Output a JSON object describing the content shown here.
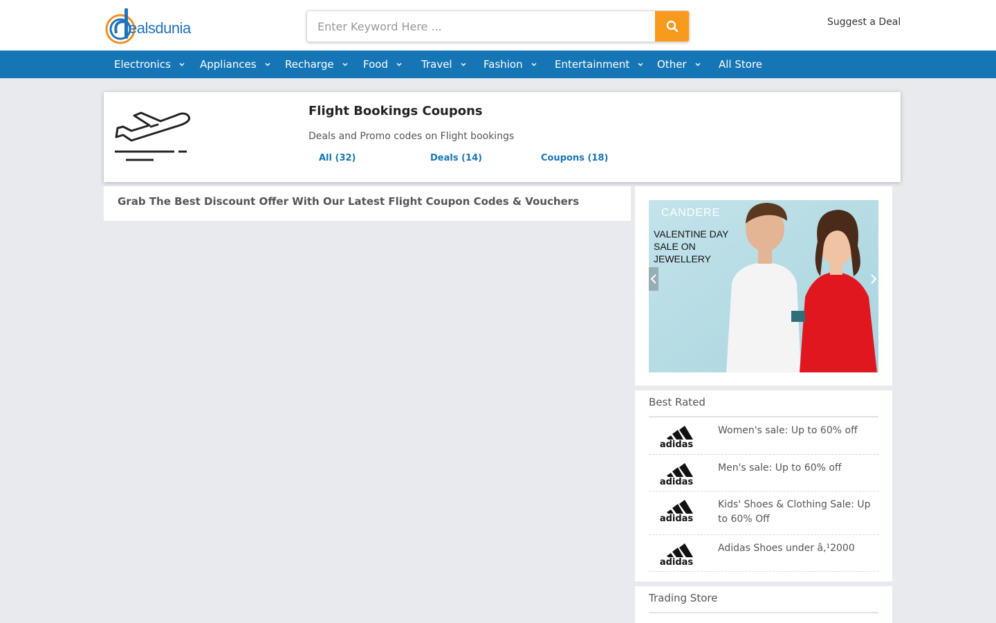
{
  "header": {
    "logo_text_a": "d",
    "logo_text_b": "ealsdunia",
    "search_placeholder": "Enter Keyword Here ...",
    "search_value": "",
    "suggest_label": "Suggest a Deal",
    "colors": {
      "brand_blue": "#1676b5",
      "brand_orange": "#f89a1c"
    }
  },
  "nav": {
    "items": [
      {
        "label": "Electronics",
        "has_dropdown": true
      },
      {
        "label": "Appliances",
        "has_dropdown": true
      },
      {
        "label": "Recharge",
        "has_dropdown": true
      },
      {
        "label": "Food",
        "has_dropdown": true
      },
      {
        "label": "Travel",
        "has_dropdown": true
      },
      {
        "label": "Fashion",
        "has_dropdown": true
      },
      {
        "label": "Entertainment",
        "has_dropdown": true
      },
      {
        "label": "Other",
        "has_dropdown": true
      },
      {
        "label": "All Store",
        "has_dropdown": false
      }
    ]
  },
  "category": {
    "icon": "airplane-takeoff-icon",
    "title": "Flight Bookings Coupons",
    "description": "Deals and Promo codes on Flight bookings",
    "tabs": [
      {
        "label": "All (32)"
      },
      {
        "label": "Deals (14)"
      },
      {
        "label": "Coupons (18)"
      }
    ]
  },
  "main": {
    "heading": "Grab The Best Discount Offer With Our Latest Flight Coupon Codes & Vouchers"
  },
  "sidebar": {
    "slider": {
      "brand": "CANDERE",
      "text": "VALENTINE DAY SALE ON JEWELLERY"
    },
    "best_rated": {
      "title": "Best Rated",
      "items": [
        {
          "store": "adidas",
          "text": "Women's sale: Up to 60% off"
        },
        {
          "store": "adidas",
          "text": "Men's sale: Up to 60% off"
        },
        {
          "store": "adidas",
          "text": "Kids' Shoes & Clothing Sale: Up to 60% Off"
        },
        {
          "store": "adidas",
          "text": "Adidas Shoes under â‚¹2000"
        }
      ]
    },
    "trading_store": {
      "title": "Trading Store"
    }
  }
}
